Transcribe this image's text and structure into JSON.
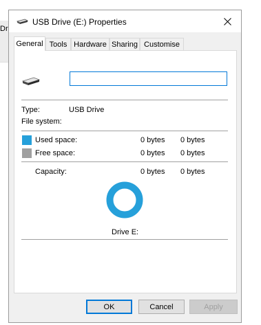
{
  "background": {
    "partial_text": "Dri"
  },
  "window": {
    "title": "USB Drive (E:) Properties",
    "close_icon": "close-icon"
  },
  "tabs": [
    {
      "label": "General",
      "active": true
    },
    {
      "label": "Tools"
    },
    {
      "label": "Hardware"
    },
    {
      "label": "Sharing"
    },
    {
      "label": "Customise"
    }
  ],
  "general": {
    "name_value": "",
    "type_label": "Type:",
    "type_value": "USB Drive",
    "fs_label": "File system:",
    "fs_value": "",
    "used_label": "Used space:",
    "used_bytes": "0 bytes",
    "used_size": "0 bytes",
    "free_label": "Free space:",
    "free_bytes": "0 bytes",
    "free_size": "0 bytes",
    "capacity_label": "Capacity:",
    "capacity_bytes": "0 bytes",
    "capacity_size": "0 bytes",
    "drive_label": "Drive E:",
    "colors": {
      "used": "#26a0da",
      "free": "#a0a0a0",
      "donut": "#26a0da"
    }
  },
  "buttons": {
    "ok": "OK",
    "cancel": "Cancel",
    "apply": "Apply"
  }
}
